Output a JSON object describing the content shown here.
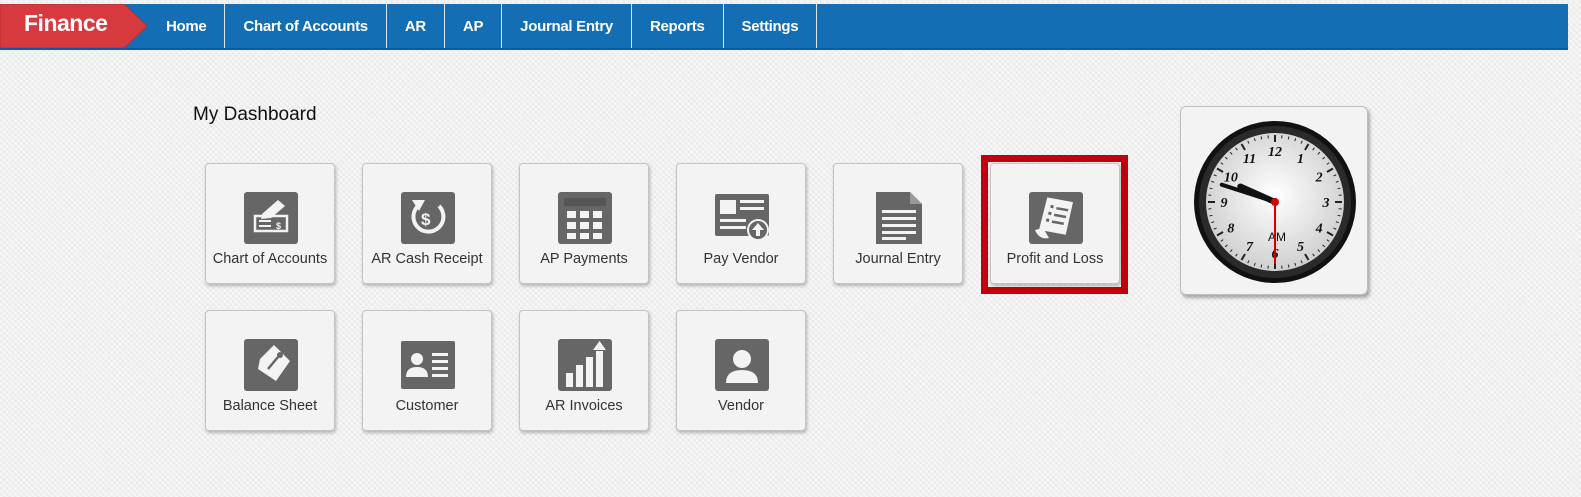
{
  "brand": {
    "label": "Finance",
    "color": "#d63a3e"
  },
  "nav": {
    "items": [
      {
        "label": "Home"
      },
      {
        "label": "Chart of Accounts"
      },
      {
        "label": "AR"
      },
      {
        "label": "AP"
      },
      {
        "label": "Journal Entry"
      },
      {
        "label": "Reports"
      },
      {
        "label": "Settings"
      }
    ],
    "bar_color": "#146eb4"
  },
  "dashboard": {
    "title": "My Dashboard",
    "highlight_color": "#c0000b",
    "tiles": [
      {
        "label": "Chart of Accounts",
        "icon": "check-icon"
      },
      {
        "label": "AR Cash Receipt",
        "icon": "dollar-refresh-icon"
      },
      {
        "label": "AP Payments",
        "icon": "grid-icon"
      },
      {
        "label": "Pay Vendor",
        "icon": "document-upload-icon"
      },
      {
        "label": "Journal Entry",
        "icon": "document-icon"
      },
      {
        "label": "Profit and Loss",
        "icon": "receipt-icon",
        "highlighted": true
      },
      {
        "label": "Balance Sheet",
        "icon": "tag-icon"
      },
      {
        "label": "Customer",
        "icon": "id-card-icon"
      },
      {
        "label": "AR Invoices",
        "icon": "bar-chart-icon"
      },
      {
        "label": "Vendor",
        "icon": "user-icon"
      }
    ]
  },
  "clock": {
    "period": "AM",
    "numerals": [
      "12",
      "1",
      "2",
      "3",
      "4",
      "5",
      "6",
      "7",
      "8",
      "9",
      "10",
      "11"
    ],
    "hour": 9,
    "minute": 48,
    "second": 30
  }
}
